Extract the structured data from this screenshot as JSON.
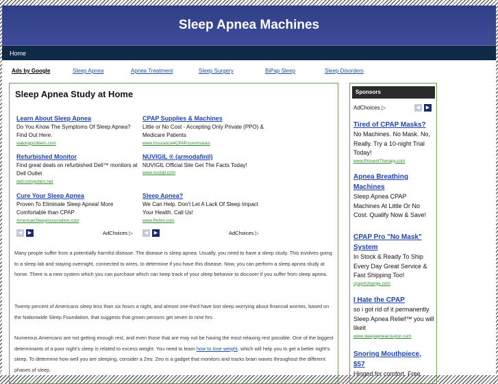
{
  "site": {
    "title": "Sleep Apnea Machines"
  },
  "nav": {
    "home": "Home"
  },
  "ad_links": {
    "label": "Ads by Google",
    "items": [
      "Sleep Apnea",
      "Apnea Treatment",
      "Sleep Surgery",
      "BiPap Sleep",
      "Sleep Disorders"
    ]
  },
  "main": {
    "title": "Sleep Apnea Study at Home",
    "ads": [
      {
        "title": "Learn About Sleep Apnea",
        "text": "Do You Know The Symptoms Of Sleep Apnea? Find Out Here.",
        "url": "wakingproblem.com"
      },
      {
        "title": "CPAP Supplies & Machines",
        "text": "Little or No Cost - Accepting Only Private (PPO) & Medicare Patients",
        "url": "www.Insurance4CPAP.com/masks"
      },
      {
        "title": "Refurbished Monitor",
        "text": "Find great deals on refurbished Dell™ monitors at Dell Outlet",
        "url": "dell-computers.net"
      },
      {
        "title": "NUVIGIL ® (armodafinil)",
        "text": "NUVIGIL Official Site Get The Facts Today!",
        "url": "www.nuvigil.com"
      },
      {
        "title": "Cure Your Sleep Apnea",
        "text": "Proven To Eliminate Sleep Apnea! More Comfortable than CPAP",
        "url": "AmericanSleepAssociation.com"
      },
      {
        "title": "Sleep Apnea?",
        "text": "We Can Help. Don't Let A Lack Of Sleep Impact Your Health. Call Us!",
        "url": "www.Pehni.com"
      }
    ],
    "adchoices": "AdChoices",
    "arrow_prev": "◀",
    "arrow_next": "▶",
    "paragraphs": {
      "p1": "Many people suffer from a potentially harmful disease. The disease is sleep apnea. Usually, you need to have a sleep study. This involves going to a sleep lab and staying overnight, connected to wires, to determine if you have this disease.  Now, you can perform a sleep apnea study at home. There is a new system which you can purchase which can keep track of your sleep behavior to discover if you suffer from sleep apnea.",
      "p2": "Twenty percent of Americans sleep less than six hours a night, and almost one-third have lost sleep worrying about financial worries, based on the Nationwide Sleep Foundation, that suggests that grown persons get seven to nine hrs.",
      "p3_before": "Numerous Americans are not getting enough rest, and even those that are may not be having the most relaxing rest possible. One of the biggest determinants of a poor night's sleep is related to excess weight. You need to learn ",
      "p3_link": "how to lose weight",
      "p3_after": ", which will help you to get a better night's sleep.  To determine how well you are sleeping, consider a Zeo. Zeo is a gadget that monitors and tracks brain waves throughout the different phases of sleep."
    }
  },
  "sidebar": {
    "title": "Sponsors",
    "adchoices": "AdChoices",
    "ads": [
      {
        "title": "Tired of CPAP Masks?",
        "text": "No Machines. No Mask. No, Really. Try a 10-night Trial Today!",
        "url": "www.ProventTherapy.com"
      },
      {
        "title": "Apnea Breathing Machines",
        "text": "Sleep Apnea CPAP Machines At Little Or No Cost. Qualify Now & Save!",
        "url": ""
      },
      {
        "title": "CPAP Pro \"No Mask\" System",
        "text": "In Stock & Ready To Ship Every Day Great Service & Fast Shipping Too!",
        "url": "cpapXchange.com"
      },
      {
        "title": "I Hate the CPAP",
        "text": "so i got rid of it permanently Sleep Apnea Relief™ you will likeit",
        "url": "www.sleepapneacoupon.com"
      },
      {
        "title": "Snoring Mouthpiece, $57",
        "text": "Hinged for comfort. Free",
        "url": ""
      }
    ]
  }
}
